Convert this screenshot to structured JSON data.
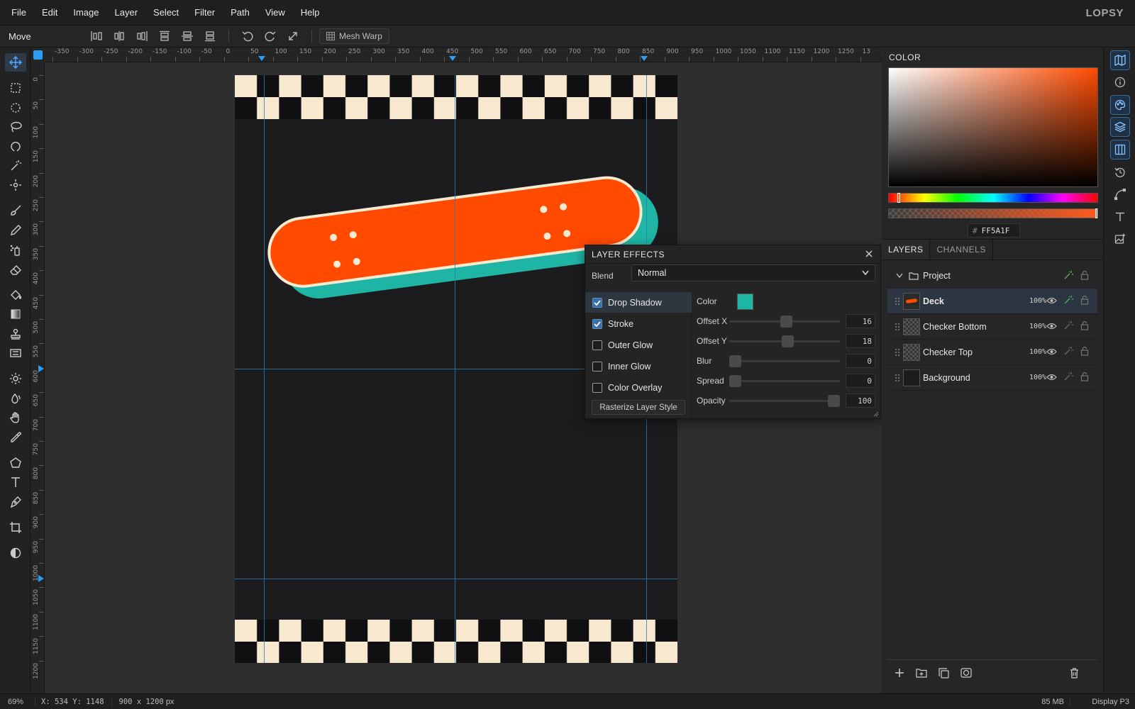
{
  "app": {
    "logo": "LOPSY"
  },
  "menu": [
    "File",
    "Edit",
    "Image",
    "Layer",
    "Select",
    "Filter",
    "Path",
    "View",
    "Help"
  ],
  "options": {
    "tool": "Move",
    "mesh_warp": "Mesh Warp"
  },
  "ruler": {
    "top": [
      "-350",
      "-300",
      "-250",
      "-200",
      "-150",
      "-100",
      "-50",
      "0",
      "50",
      "100",
      "150",
      "200",
      "250",
      "300",
      "350",
      "400",
      "450",
      "500",
      "550",
      "600",
      "650",
      "700",
      "750",
      "800",
      "850",
      "900",
      "950",
      "1000",
      "1050",
      "1100",
      "1150",
      "1200",
      "1250",
      "13"
    ],
    "left": [
      "0",
      "50",
      "100",
      "150",
      "200",
      "250",
      "300",
      "350",
      "400",
      "450",
      "500",
      "550",
      "600",
      "650",
      "700",
      "750",
      "800",
      "850",
      "900",
      "950",
      "1000",
      "1050",
      "1100",
      "1150",
      "1200"
    ]
  },
  "color_panel": {
    "title": "COLOR",
    "hex_prefix": "#",
    "hex": "FF5A1F",
    "current": "#ff5a1f"
  },
  "layers_panel": {
    "tabs": [
      "LAYERS",
      "CHANNELS"
    ],
    "group": "Project",
    "items": [
      {
        "name": "Deck",
        "opacity": "100%"
      },
      {
        "name": "Checker Bottom",
        "opacity": "100%"
      },
      {
        "name": "Checker Top",
        "opacity": "100%"
      },
      {
        "name": "Background",
        "opacity": "100%"
      }
    ]
  },
  "layer_effects": {
    "title": "LAYER EFFECTS",
    "blend_label": "Blend",
    "blend_value": "Normal",
    "effects": [
      {
        "label": "Drop Shadow",
        "checked": true
      },
      {
        "label": "Stroke",
        "checked": true
      },
      {
        "label": "Outer Glow",
        "checked": false
      },
      {
        "label": "Inner Glow",
        "checked": false
      },
      {
        "label": "Color Overlay",
        "checked": false
      }
    ],
    "rasterize": "Rasterize Layer Style",
    "color_label": "Color",
    "shadow_color": "#1fb5a4",
    "params": [
      {
        "label": "Offset X",
        "value": "16",
        "level": 0.52
      },
      {
        "label": "Offset Y",
        "value": "18",
        "level": 0.53
      },
      {
        "label": "Blur",
        "value": "0",
        "level": 0.0
      },
      {
        "label": "Spread",
        "value": "0",
        "level": 0.0
      },
      {
        "label": "Opacity",
        "value": "100",
        "level": 1.0
      }
    ]
  },
  "status": {
    "zoom": "69%",
    "cursor_x": "X: 534",
    "cursor_y": "Y: 1148",
    "doc_size": "900 x 1200",
    "doc_unit": "px",
    "memory": "85 MB",
    "profile": "Display P3"
  },
  "canvas": {
    "deck_color": "#ff4a00",
    "stroke_color": "#f7ead0",
    "checker_light": "#f7e8cf",
    "checker_dark": "#101012"
  }
}
